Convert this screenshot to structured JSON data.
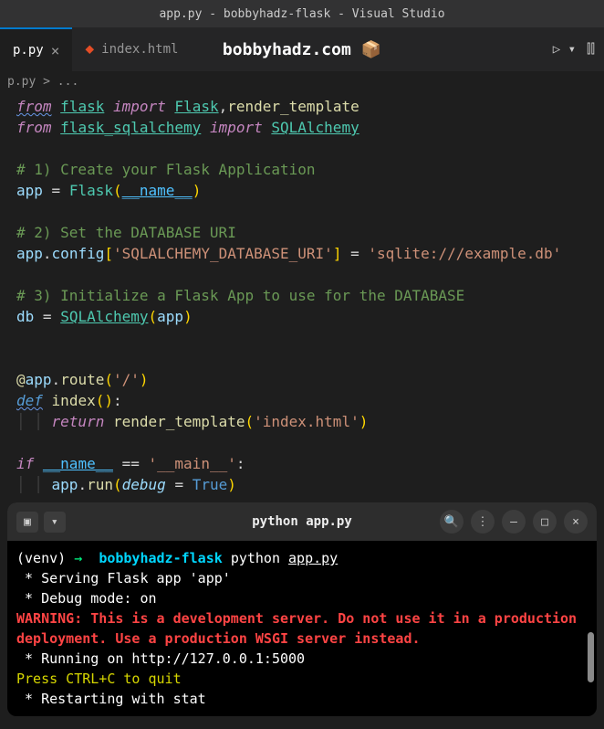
{
  "title": "app.py - bobbyhadz-flask - Visual Studio",
  "tabs": [
    {
      "name": "p.py",
      "active": true
    },
    {
      "name": "index.html",
      "active": false
    }
  ],
  "watermark": "bobbyhadz.com 📦",
  "breadcrumb": "p.py > ...",
  "code": {
    "l1": {
      "from": "from",
      "mod": "flask",
      "import": "import",
      "cls": "Flask",
      "comma": ",",
      "fn": "render_template"
    },
    "l2": {
      "from": "from",
      "mod": "flask_sqlalchemy",
      "import": "import",
      "cls": "SQLAlchemy"
    },
    "c1": "# 1) Create your Flask Application",
    "l4": {
      "var": "app",
      "eq": "=",
      "cls": "Flask",
      "lp": "(",
      "dunder": "__name__",
      "rp": ")"
    },
    "c2": "# 2) Set the DATABASE URI",
    "l6": {
      "var": "app",
      "dot": ".",
      "attr": "config",
      "lb": "[",
      "key": "'SQLALCHEMY_DATABASE_URI'",
      "rb": "]",
      "eq": "=",
      "val": "'sqlite:///example.db'"
    },
    "c3": "# 3) Initialize a Flask App to use for the DATABASE",
    "l8": {
      "var": "db",
      "eq": "=",
      "cls": "SQLAlchemy",
      "lp": "(",
      "arg": "app",
      "rp": ")"
    },
    "l9": {
      "at": "@",
      "obj": "app",
      "dot": ".",
      "fn": "route",
      "lp": "(",
      "path": "'/'",
      "rp": ")"
    },
    "l10": {
      "def": "def",
      "fn": "index",
      "lp": "(",
      "rp": ")",
      "colon": ":"
    },
    "l11": {
      "ret": "return",
      "fn": "render_template",
      "lp": "(",
      "arg": "'index.html'",
      "rp": ")"
    },
    "l12": {
      "if": "if",
      "name": "__name__",
      "eq": "==",
      "main": "'__main__'",
      "colon": ":"
    },
    "l13": {
      "obj": "app",
      "dot": ".",
      "fn": "run",
      "lp": "(",
      "kw": "debug",
      "eq2": "=",
      "val": "True",
      "rp": ")"
    }
  },
  "terminal": {
    "title": "python app.py",
    "prompt": {
      "venv": "(venv)",
      "arrow": "→",
      "path": "bobbyhadz-flask",
      "cmd1": "python",
      "cmd2": "app.py"
    },
    "out1": " * Serving Flask app 'app'",
    "out2": " * Debug mode: on",
    "warn": "WARNING: This is a development server. Do not use it in a production deployment. Use a production WSGI server instead.",
    "out3": " * Running on http://127.0.0.1:5000",
    "out4": "Press CTRL+C to quit",
    "out5": " * Restarting with stat"
  }
}
